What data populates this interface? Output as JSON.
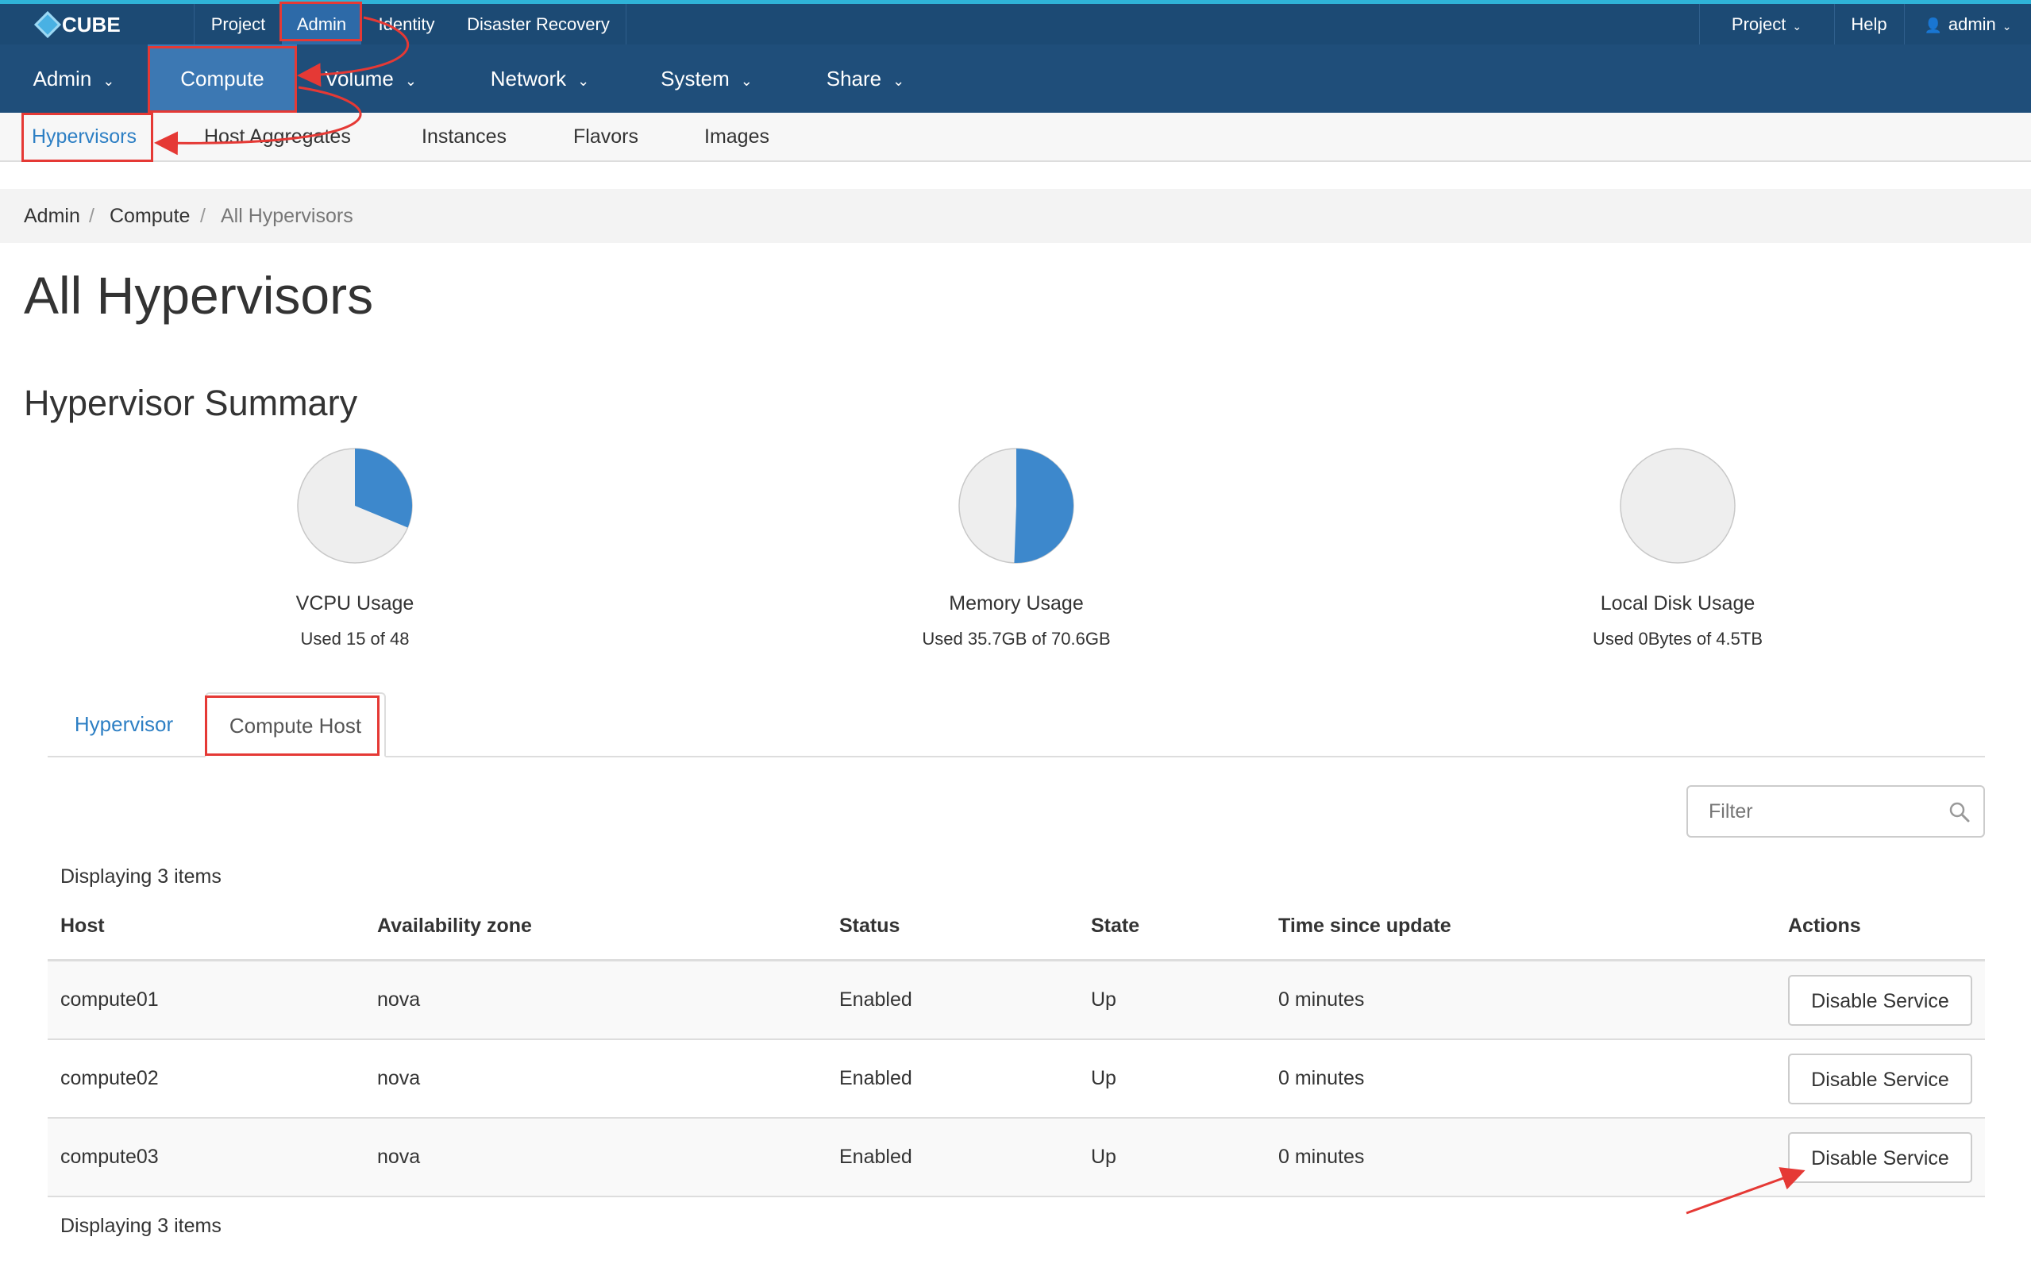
{
  "topbar": {
    "brand": "CUBE",
    "tabs": [
      "Project",
      "Admin",
      "Identity",
      "Disaster Recovery"
    ],
    "right": {
      "project": "Project",
      "help": "Help",
      "user": "admin"
    }
  },
  "main_nav": [
    {
      "label": "Admin",
      "dropdown": true
    },
    {
      "label": "Compute",
      "dropdown": false
    },
    {
      "label": "Volume",
      "dropdown": true
    },
    {
      "label": "Network",
      "dropdown": true
    },
    {
      "label": "System",
      "dropdown": true
    },
    {
      "label": "Share",
      "dropdown": true
    }
  ],
  "sub_nav": [
    "Hypervisors",
    "Host Aggregates",
    "Instances",
    "Flavors",
    "Images"
  ],
  "breadcrumb": [
    "Admin",
    "Compute",
    "All Hypervisors"
  ],
  "page_title": "All Hypervisors",
  "summary": {
    "heading": "Hypervisor Summary",
    "charts": [
      {
        "label": "VCPU Usage",
        "sub": "Used 15 of 48",
        "used": 15,
        "total": 48
      },
      {
        "label": "Memory Usage",
        "sub": "Used 35.7GB of 70.6GB",
        "used": 35.7,
        "total": 70.6
      },
      {
        "label": "Local Disk Usage",
        "sub": "Used 0Bytes of 4.5TB",
        "used": 0,
        "total": 4.5
      }
    ]
  },
  "tabs": [
    "Hypervisor",
    "Compute Host"
  ],
  "filter": {
    "placeholder": "Filter"
  },
  "table": {
    "count_text": "Displaying 3 items",
    "columns": [
      "Host",
      "Availability zone",
      "Status",
      "State",
      "Time since update",
      "Actions"
    ],
    "rows": [
      {
        "host": "compute01",
        "zone": "nova",
        "status": "Enabled",
        "state": "Up",
        "updated": "0 minutes",
        "action": "Disable Service"
      },
      {
        "host": "compute02",
        "zone": "nova",
        "status": "Enabled",
        "state": "Up",
        "updated": "0 minutes",
        "action": "Disable Service"
      },
      {
        "host": "compute03",
        "zone": "nova",
        "status": "Enabled",
        "state": "Up",
        "updated": "0 minutes",
        "action": "Disable Service"
      }
    ]
  },
  "colors": {
    "topbar": "#1c4a74",
    "topbar_accent": "#2fb3d8",
    "nav": "#1f4e7a",
    "nav_active": "#3c78b3",
    "link": "#2d7fc4",
    "pie_used": "#3d88cc",
    "pie_free": "#eeeeee",
    "annotation": "#e53935"
  }
}
